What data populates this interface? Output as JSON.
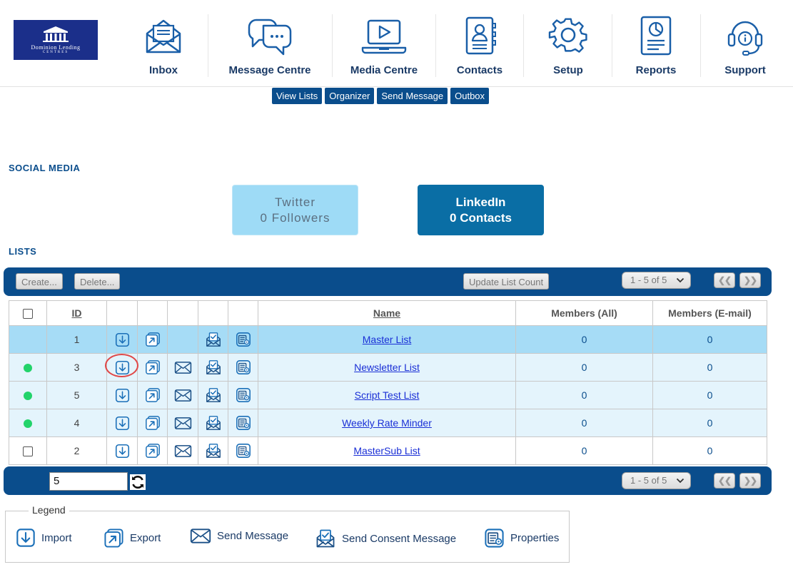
{
  "brand": {
    "logo_line1": "Dominion Lending",
    "logo_line2": "CENTRES",
    "accent": "#0a4d8c",
    "icon_color": "#1a5fa8"
  },
  "nav": {
    "inbox": "Inbox",
    "message_centre": "Message Centre",
    "media_centre": "Media Centre",
    "contacts": "Contacts",
    "setup": "Setup",
    "reports": "Reports",
    "support": "Support"
  },
  "subnav": {
    "view_lists": "View Lists",
    "organizer": "Organizer",
    "send_message": "Send Message",
    "outbox": "Outbox"
  },
  "social": {
    "title": "SOCIAL MEDIA",
    "twitter_name": "Twitter",
    "twitter_count": "0 Followers",
    "linkedin_name": "LinkedIn",
    "linkedin_count": "0 Contacts"
  },
  "lists": {
    "title": "LISTS",
    "toolbar": {
      "create": "Create...",
      "delete": "Delete...",
      "update_count": "Update List Count",
      "page_range": "1 - 5 of 5",
      "prev": "❮❮",
      "next": "❯❯"
    },
    "columns": {
      "id": "ID",
      "name": "Name",
      "members_all": "Members (All)",
      "members_email": "Members (E-mail)"
    },
    "rows": [
      {
        "id": "1",
        "name": "Master List",
        "members_all": "0",
        "members_email": "0",
        "status": "selected"
      },
      {
        "id": "3",
        "name": "Newsletter List",
        "members_all": "0",
        "members_email": "0",
        "status": "active"
      },
      {
        "id": "5",
        "name": "Script Test List",
        "members_all": "0",
        "members_email": "0",
        "status": "active"
      },
      {
        "id": "4",
        "name": "Weekly Rate Minder",
        "members_all": "0",
        "members_email": "0",
        "status": "active"
      },
      {
        "id": "2",
        "name": "MasterSub List",
        "members_all": "0",
        "members_email": "0",
        "status": "checkbox"
      }
    ],
    "footer": {
      "page_size": "5",
      "page_range": "1 - 5 of 5",
      "prev": "❮❮",
      "next": "❯❯"
    }
  },
  "legend": {
    "title": "Legend",
    "import": "Import",
    "export": "Export",
    "send_message": "Send Message",
    "send_consent": "Send Consent Message",
    "properties": "Properties"
  }
}
